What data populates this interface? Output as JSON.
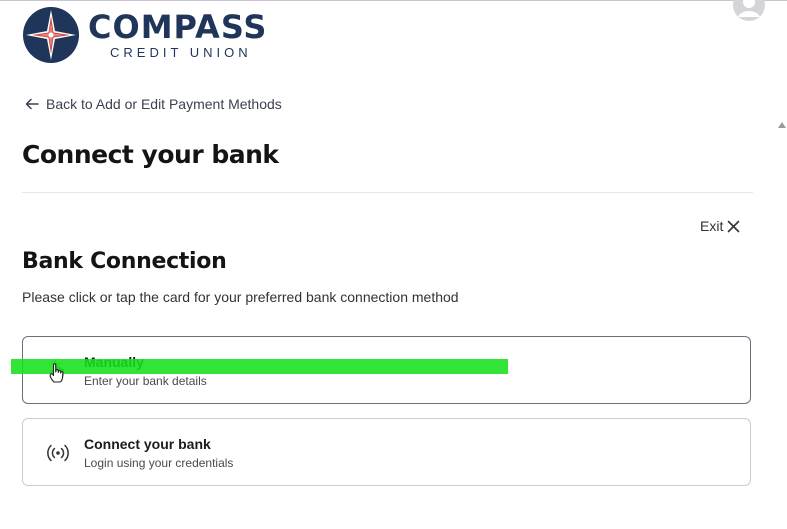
{
  "header": {
    "brand_name": "COMPASS",
    "brand_sub": "CREDIT UNION",
    "avatar_icon": "user-avatar-icon"
  },
  "nav": {
    "back_label": "Back to Add or Edit Payment Methods",
    "back_icon": "arrow-left-icon"
  },
  "page": {
    "title": "Connect your bank",
    "exit_label": "Exit",
    "exit_icon": "close-icon"
  },
  "section": {
    "title": "Bank Connection",
    "instructions": "Please click or tap the card for your preferred bank connection method"
  },
  "options": [
    {
      "title": "Manually",
      "description": "Enter your bank details",
      "icon": "hand-pointer-icon"
    },
    {
      "title": "Connect your bank",
      "description": "Login using your credentials",
      "icon": "wireless-signal-icon"
    }
  ],
  "colors": {
    "brand_navy": "#1f3559",
    "brand_red": "#d2423a",
    "highlight": "#16e01b"
  }
}
